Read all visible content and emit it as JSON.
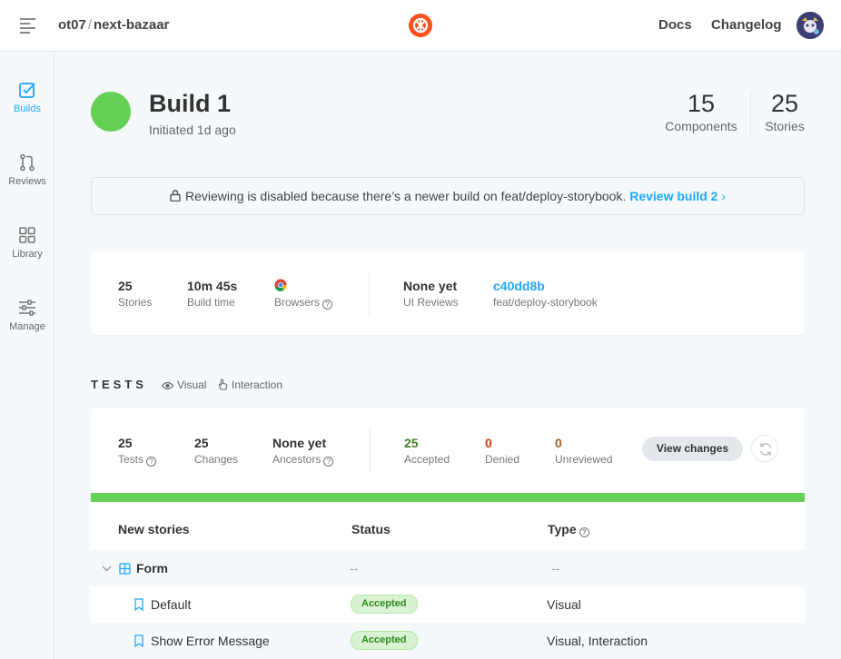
{
  "topbar": {
    "repo_owner": "ot07",
    "repo_sep": "/",
    "repo_name": "next-bazaar",
    "links": {
      "docs": "Docs",
      "changelog": "Changelog"
    }
  },
  "sidebar": {
    "items": [
      {
        "label": "Builds",
        "icon": "checkbox-icon",
        "active": true
      },
      {
        "label": "Reviews",
        "icon": "pull-request-icon",
        "active": false
      },
      {
        "label": "Library",
        "icon": "grid-icon",
        "active": false
      },
      {
        "label": "Manage",
        "icon": "sliders-icon",
        "active": false
      }
    ]
  },
  "header": {
    "title": "Build 1",
    "subtitle": "Initiated 1d ago",
    "status_color": "#66d057",
    "components": {
      "value": "15",
      "label": "Components"
    },
    "stories": {
      "value": "25",
      "label": "Stories"
    }
  },
  "banner": {
    "text": "Reviewing is disabled because there’s a newer build on feat/deploy-storybook.",
    "link": "Review build 2",
    "link_color": "#1ea7fd"
  },
  "summary": {
    "stories": {
      "value": "25",
      "label": "Stories"
    },
    "build_time": {
      "value": "10m 45s",
      "label": "Build time"
    },
    "browsers": {
      "label": "Browsers",
      "icon": "chrome-icon"
    },
    "ui_reviews": {
      "value": "None yet",
      "label": "UI Reviews"
    },
    "commit": {
      "value": "c40dd8b",
      "label": "feat/deploy-storybook"
    }
  },
  "tests": {
    "title": "TESTS",
    "tags": {
      "visual": "Visual",
      "interaction": "Interaction"
    },
    "stats": {
      "tests": {
        "value": "25",
        "label": "Tests"
      },
      "changes": {
        "value": "25",
        "label": "Changes"
      },
      "ancestors": {
        "value": "None yet",
        "label": "Ancestors"
      },
      "accepted": {
        "value": "25",
        "label": "Accepted",
        "color": "#448028"
      },
      "denied": {
        "value": "0",
        "label": "Denied",
        "color": "#d43900"
      },
      "unreviewed": {
        "value": "0",
        "label": "Unreviewed",
        "color": "#a15c20"
      }
    },
    "view_changes": "View changes",
    "progress_accepted_fraction": 1.0
  },
  "table": {
    "headers": {
      "name": "New stories",
      "status": "Status",
      "type": "Type"
    },
    "group": {
      "name": "Form",
      "status": "--",
      "type": "--"
    },
    "rows": [
      {
        "name": "Default",
        "status": "Accepted",
        "type": "Visual"
      },
      {
        "name": "Show Error Message",
        "status": "Accepted",
        "type": "Visual, Interaction"
      }
    ]
  }
}
